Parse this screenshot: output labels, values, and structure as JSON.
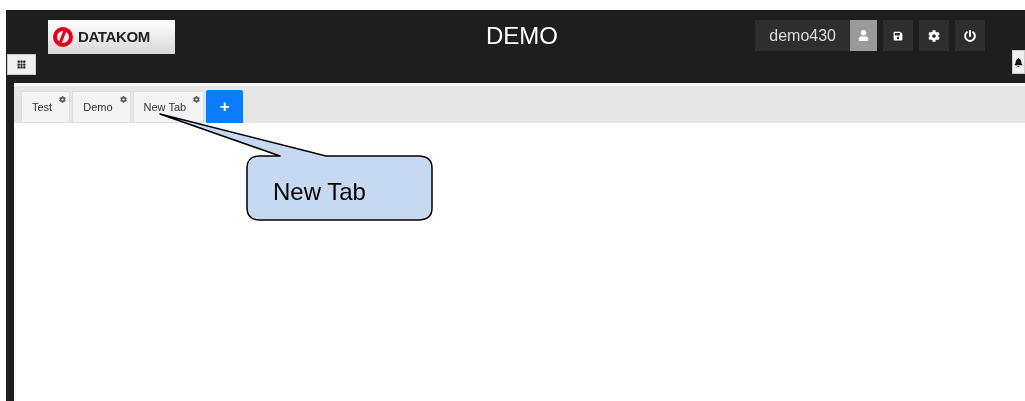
{
  "header": {
    "logo_text": "DATAKOM",
    "title": "DEMO",
    "username": "demo430"
  },
  "tabs": [
    {
      "label": "Test"
    },
    {
      "label": "Demo"
    },
    {
      "label": "New Tab"
    }
  ],
  "add_tab": "+",
  "callout": {
    "text": "New Tab"
  }
}
